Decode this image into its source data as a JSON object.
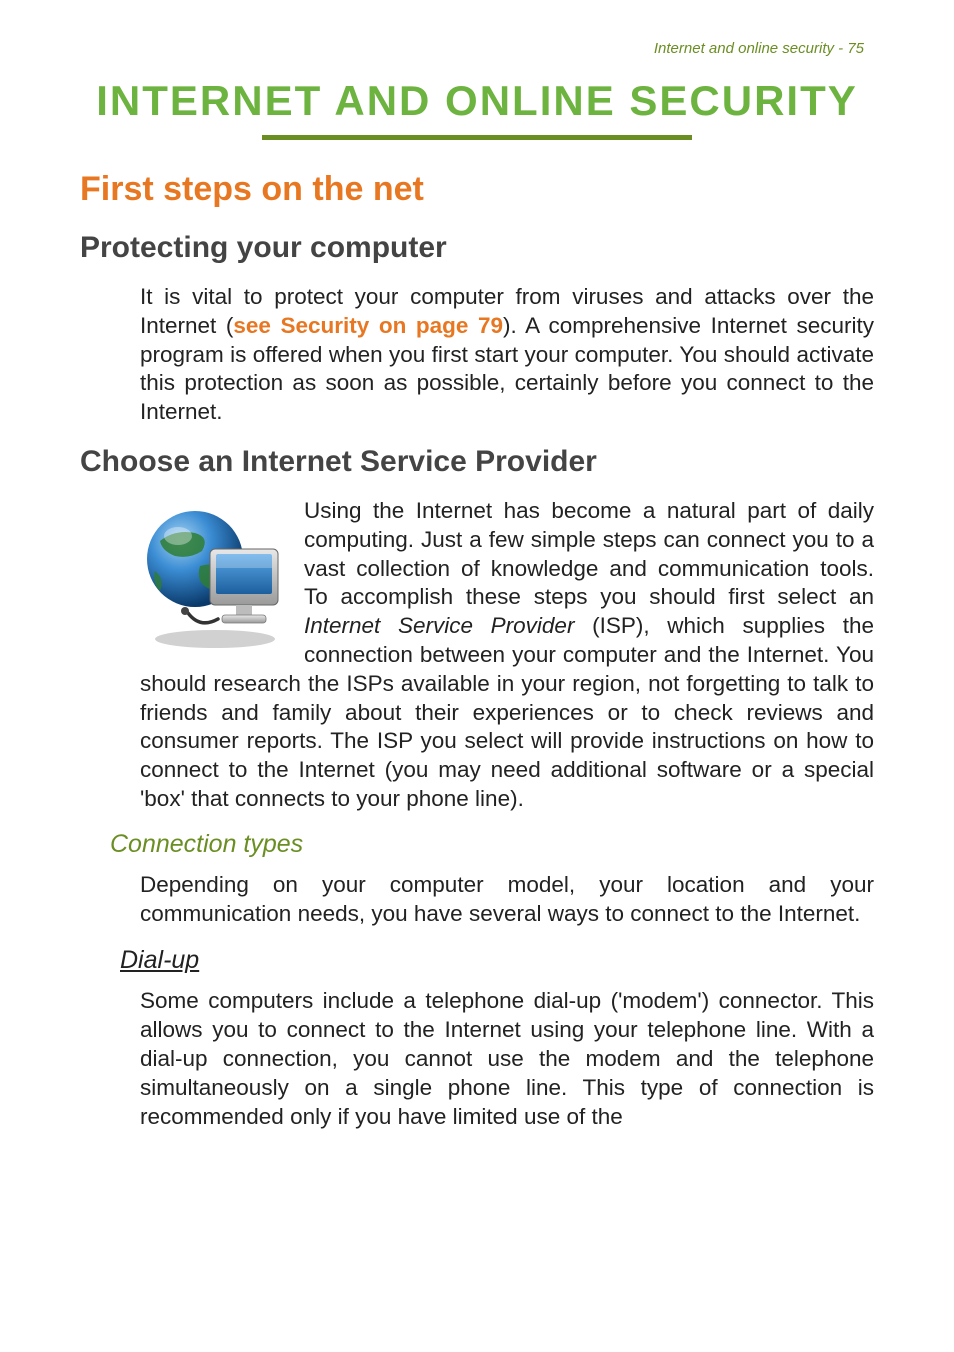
{
  "header": {
    "running": "Internet and online security - 75"
  },
  "title": "INTERNET AND ONLINE SECURITY",
  "h1": "First steps on the net",
  "s1": {
    "heading": "Protecting your computer",
    "p1a": "It is vital to protect your computer from viruses and attacks over the Internet (",
    "link": "see Security on page 79",
    "p1b": "). A comprehensive Internet security program is offered when you first start your computer. You should activate this protection as soon as possible, certainly before you connect to the Internet."
  },
  "s2": {
    "heading": "Choose an Internet Service Provider",
    "p_lead": "Using the Internet has become a natural part of daily computing. Just a few simple steps can connect you to a vast collection of knowledge and communication tools. To accomplish these steps you should first select an ",
    "isp_term": "Internet Service Provider",
    "p_mid": " (ISP), which supplies the connection between your computer and the Internet. You should research the ISPs available in ",
    "p_tail": "your region, not forgetting to talk to friends and family about their experiences or to check reviews and consumer reports. The ISP you select will provide instructions on how to connect to the Internet (you may need additional software or a special 'box' that connects to your phone line)."
  },
  "s3": {
    "heading": "Connection types",
    "p": "Depending on your computer model, your location and your communication needs, you have several ways to connect to the Internet."
  },
  "s4": {
    "heading": "Dial-up",
    "p": "Some computers include a telephone dial-up ('modem') connector. This allows you to connect to the Internet using your telephone line. With a dial-up connection, you cannot use the modem and the telephone simultaneously on a single phone line. This type of connection is recommended only if you have limited use of the"
  }
}
